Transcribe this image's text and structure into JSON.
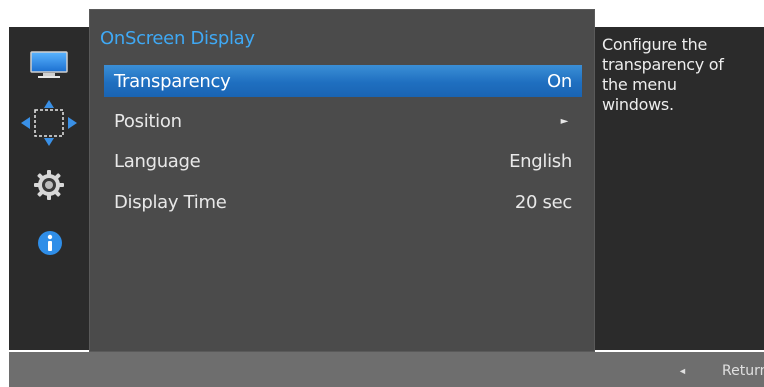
{
  "menu": {
    "title": "OnScreen Display",
    "items": [
      {
        "label": "Transparency",
        "value": "On",
        "selected": true
      },
      {
        "label": "Position",
        "value": "►",
        "selected": false
      },
      {
        "label": "Language",
        "value": "English",
        "selected": false
      },
      {
        "label": "Display Time",
        "value": "20 sec",
        "selected": false
      }
    ]
  },
  "help": {
    "text": "Configure the transparency of the menu windows."
  },
  "sidebar": {
    "icons": [
      "monitor-icon",
      "size-position-icon",
      "settings-gear-icon",
      "info-icon"
    ]
  },
  "bottom_bar": {
    "arrow": "◄",
    "label": "Return"
  },
  "colors": {
    "accent": "#3fa9f5",
    "selected_row": "#1f6fc0",
    "panel": "#4b4b4b",
    "background": "#2b2b2b"
  }
}
